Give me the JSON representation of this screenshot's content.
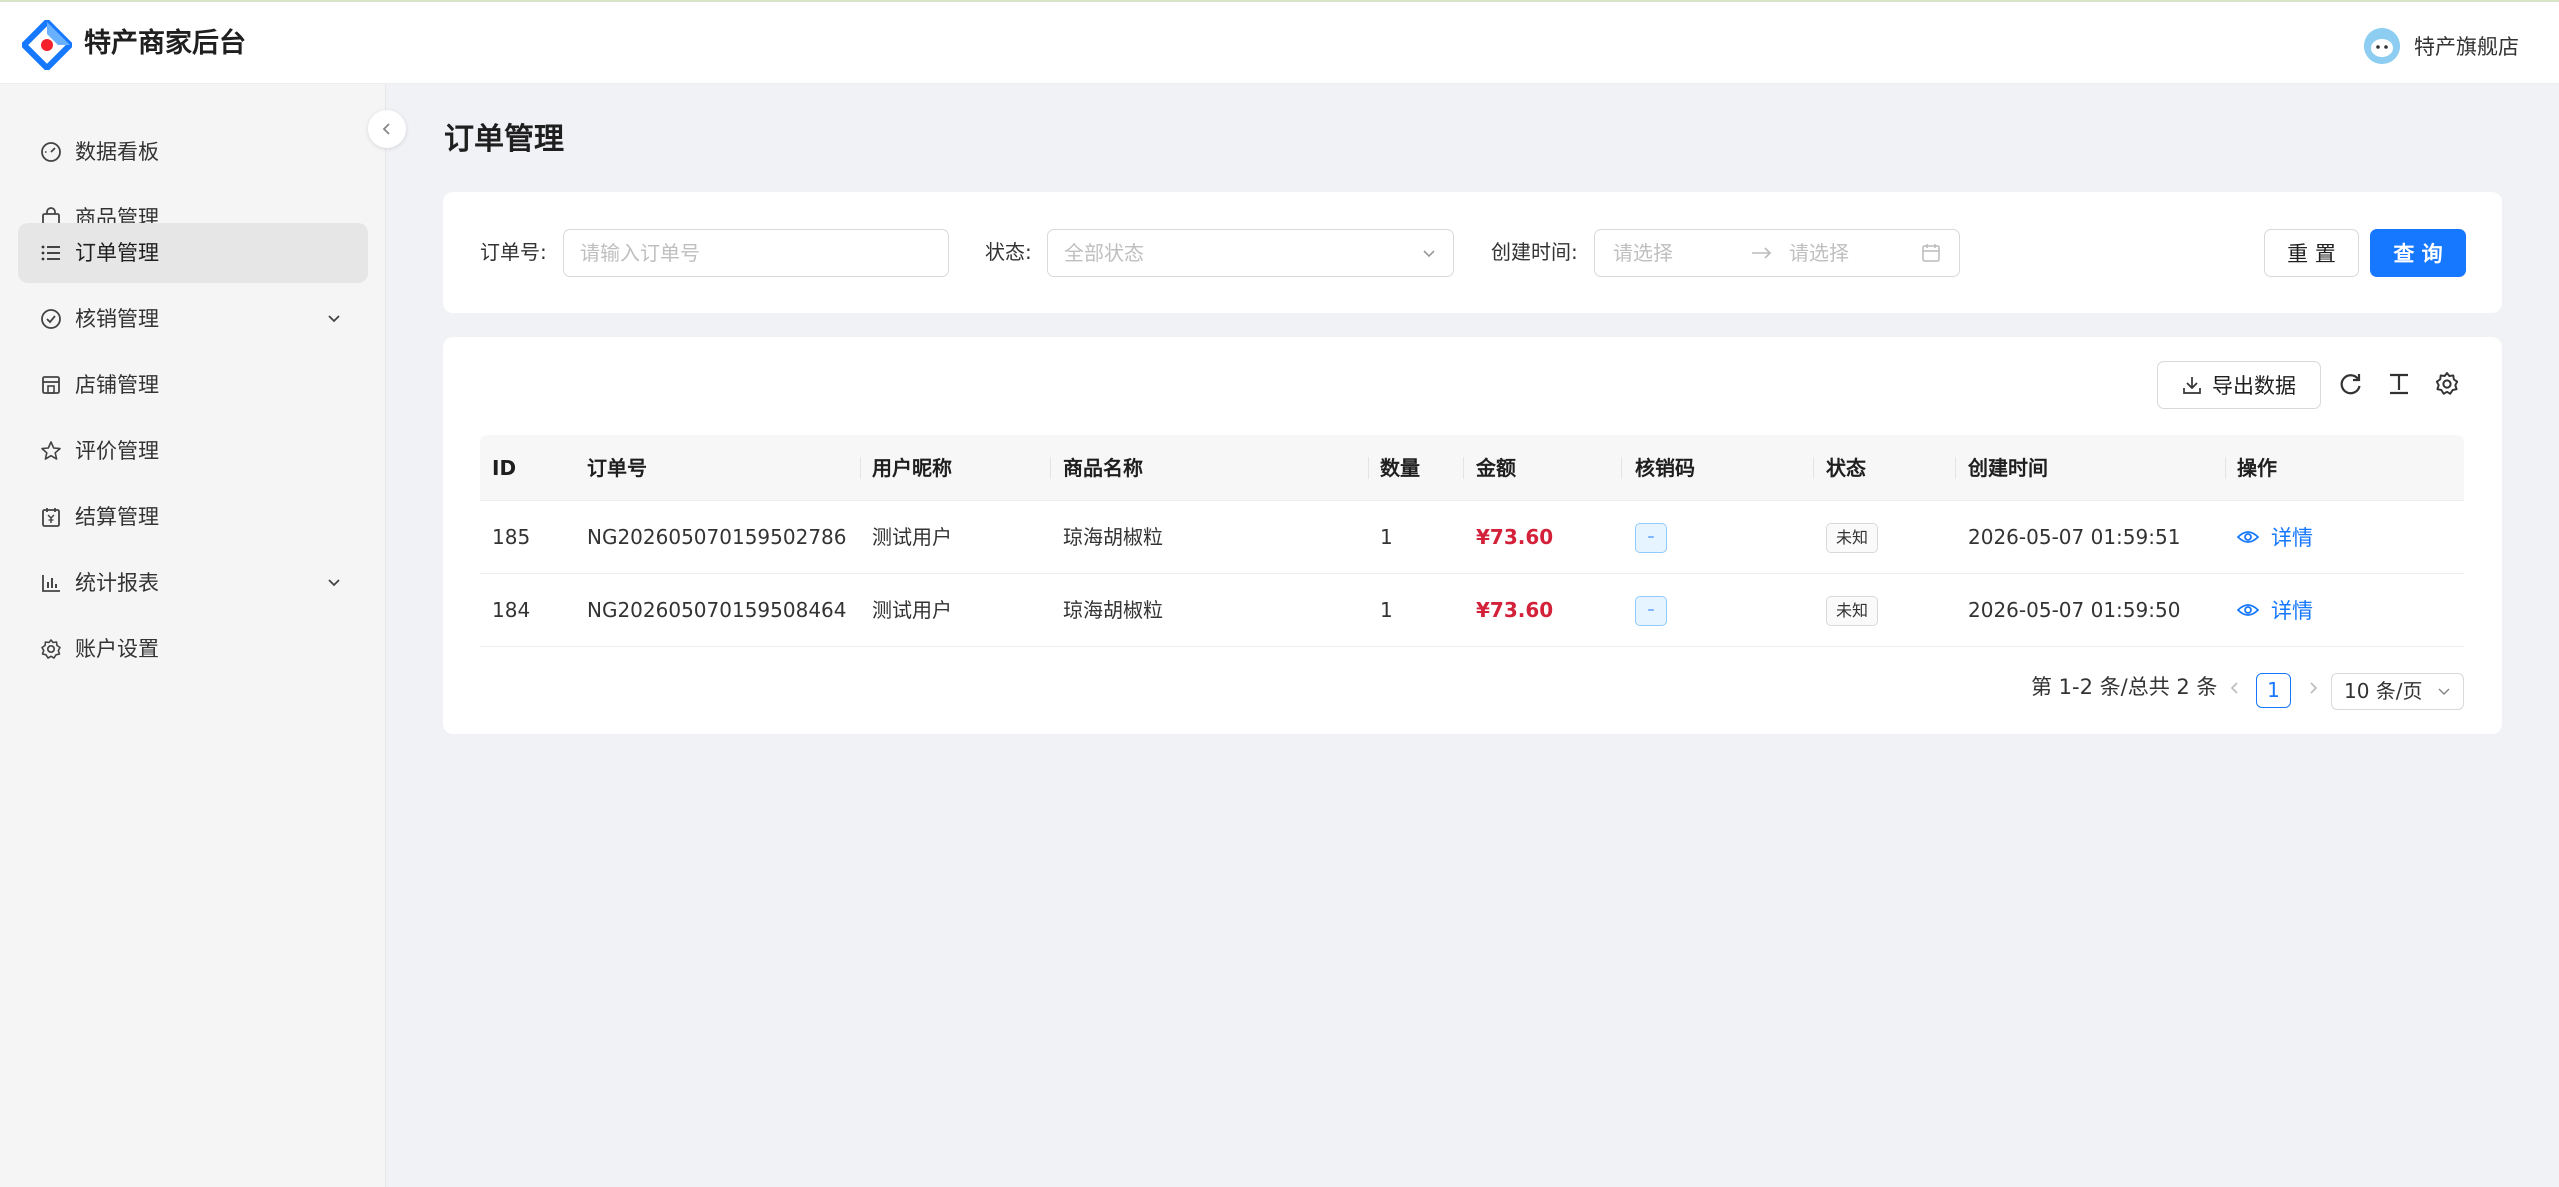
{
  "app": {
    "title": "特产商家后台",
    "user_name": "特产旗舰店"
  },
  "sidebar": {
    "items": [
      {
        "label": "数据看板",
        "icon": "dashboard-icon"
      },
      {
        "label": "商品管理",
        "icon": "shopping-bag-icon"
      },
      {
        "label": "订单管理",
        "icon": "list-icon",
        "active": true
      },
      {
        "label": "核销管理",
        "icon": "check-circle-icon",
        "expandable": true
      },
      {
        "label": "店铺管理",
        "icon": "shop-icon"
      },
      {
        "label": "评价管理",
        "icon": "star-icon"
      },
      {
        "label": "结算管理",
        "icon": "calendar-yen-icon"
      },
      {
        "label": "统计报表",
        "icon": "bar-chart-icon",
        "expandable": true
      },
      {
        "label": "账户设置",
        "icon": "gear-icon"
      }
    ]
  },
  "page": {
    "title": "订单管理"
  },
  "filters": {
    "order_no": {
      "label": "订单号:",
      "placeholder": "请输入订单号"
    },
    "status": {
      "label": "状态:",
      "placeholder": "全部状态"
    },
    "created": {
      "label": "创建时间:",
      "start_placeholder": "请选择",
      "end_placeholder": "请选择"
    },
    "reset_label": "重 置",
    "query_label": "查 询"
  },
  "toolbar": {
    "export_label": "导出数据"
  },
  "table": {
    "columns": [
      "ID",
      "订单号",
      "用户昵称",
      "商品名称",
      "数量",
      "金额",
      "核销码",
      "状态",
      "创建时间",
      "操作"
    ],
    "rows": [
      {
        "id": "185",
        "order_no": "NG202605070159502786",
        "nickname": "测试用户",
        "product": "琼海胡椒粒",
        "qty": "1",
        "amount": "¥73.60",
        "code": "–",
        "status": "未知",
        "created": "2026-05-07 01:59:51",
        "action": "详情"
      },
      {
        "id": "184",
        "order_no": "NG202605070159508464",
        "nickname": "测试用户",
        "product": "琼海胡椒粒",
        "qty": "1",
        "amount": "¥73.60",
        "code": "–",
        "status": "未知",
        "created": "2026-05-07 01:59:50",
        "action": "详情"
      }
    ]
  },
  "pagination": {
    "total_text": "第 1-2 条/总共 2 条",
    "current": "1",
    "page_size": "10 条/页"
  },
  "colors": {
    "primary": "#1677ff",
    "amount": "#d4213a"
  }
}
